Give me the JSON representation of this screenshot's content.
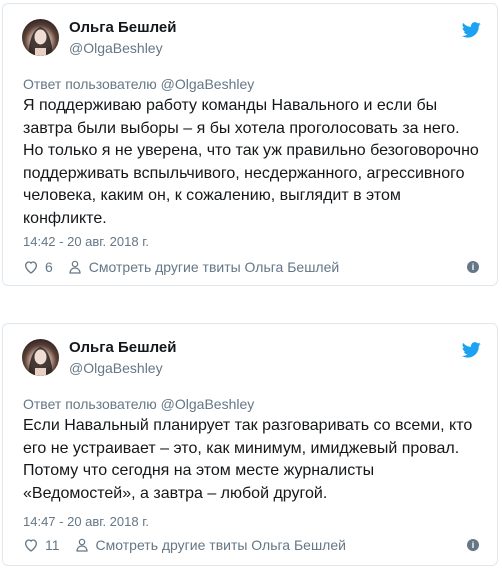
{
  "tweets": [
    {
      "name": "Ольга Бешлей",
      "handle": "@OlgaBeshley",
      "reply_to": "Ответ пользователю @OlgaBeshley",
      "lines": [
        "Я поддерживаю работу команды Навального и если бы",
        "завтра были выборы – я бы хотела проголосовать за него.",
        "Но только я не уверена, что так уж правильно безоговорочно",
        "поддерживать вспыльчивого, несдержанного, агрессивного",
        "человека, каким он, к сожалению, выглядит в этом",
        "конфликте."
      ],
      "date": "14:42 - 20 авг. 2018 г.",
      "likes": "6",
      "more_link": "Смотреть другие твиты Ольга Бешлей",
      "icons": {
        "like": "heart-icon",
        "profile": "person-icon",
        "info": "info-icon",
        "brand": "twitter-bird-icon"
      },
      "brand_color": "#1da1f2"
    },
    {
      "name": "Ольга Бешлей",
      "handle": "@OlgaBeshley",
      "reply_to": "Ответ пользователю @OlgaBeshley",
      "lines": [
        "Если Навальный планирует так разговаривать со всеми, кто",
        "его не устраивает – это, как минимум, имиджевый провал.",
        "Потому что сегодня на этом месте журналисты",
        "«Ведомостей», а завтра – любой другой."
      ],
      "date": "14:47 - 20 авг. 2018 г.",
      "likes": "11",
      "more_link": "Смотреть другие твиты Ольга Бешлей",
      "icons": {
        "like": "heart-icon",
        "profile": "person-icon",
        "info": "info-icon",
        "brand": "twitter-bird-icon"
      },
      "brand_color": "#1da1f2"
    }
  ]
}
